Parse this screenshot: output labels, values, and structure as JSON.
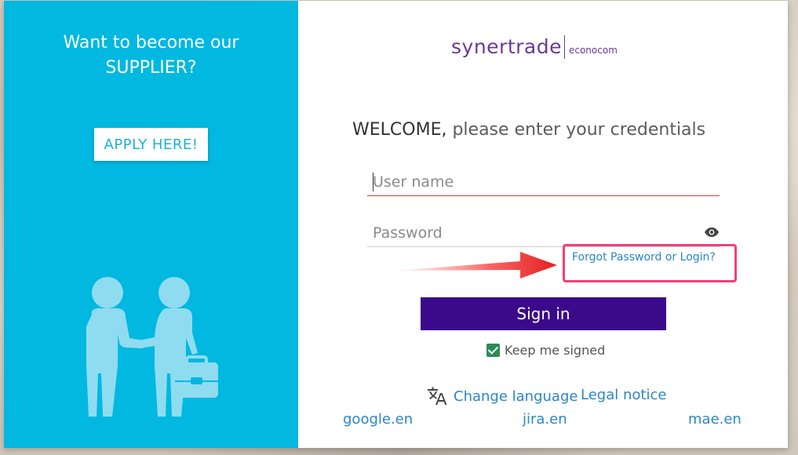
{
  "left_panel": {
    "title": "Want to become our\nSUPPLIER?",
    "apply_label": "APPLY HERE!"
  },
  "logo": {
    "main": "synertrade",
    "sub": "econocom"
  },
  "form": {
    "welcome_strong": "WELCOME,",
    "welcome_rest": " please enter your credentials",
    "username_placeholder": "User name",
    "password_placeholder": "Password",
    "forgot_label": "Forgot Password or Login?",
    "signin_label": "Sign in",
    "keep_signed_label": "Keep me signed",
    "keep_signed_checked": true
  },
  "footer": {
    "change_language_label": "Change language",
    "legal_notice_label": "Legal notice",
    "links": [
      "google.en",
      "jira.en",
      "mae.en"
    ]
  },
  "colors": {
    "left_panel_bg": "#00b8e0",
    "signin_bg": "#3b0a8a",
    "link": "#2c86c9",
    "highlight": "#f0407a"
  }
}
